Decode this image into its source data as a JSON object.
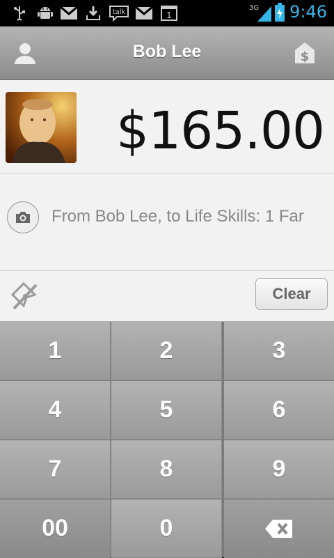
{
  "status_bar": {
    "time": "9:46",
    "network": "3G",
    "icons": [
      "usb-icon",
      "android-debug-icon",
      "gmail-icon",
      "download-icon",
      "talk-icon",
      "gmail-icon",
      "calendar-icon"
    ],
    "talk_label": "talk",
    "calendar_day": "1"
  },
  "action_bar": {
    "title": "Bob Lee",
    "left_icon": "contact-icon",
    "right_icon": "dollar-tag-icon",
    "right_symbol": "$"
  },
  "payment": {
    "amount": "$165.00",
    "avatar_icon": "avatar-photo"
  },
  "memo": {
    "text": "From Bob Lee, to Life Skills: 1 Far",
    "camera_icon": "camera-icon"
  },
  "tools": {
    "location_icon": "location-off-icon",
    "clear_label": "Clear"
  },
  "keypad": {
    "keys": [
      "1",
      "2",
      "3",
      "4",
      "5",
      "6",
      "7",
      "8",
      "9",
      "00",
      "0"
    ],
    "backspace_icon": "backspace-icon"
  },
  "colors": {
    "time": "#33b5e5",
    "action_bar": "#9f9f9f",
    "keypad": "#a6a6a6"
  }
}
